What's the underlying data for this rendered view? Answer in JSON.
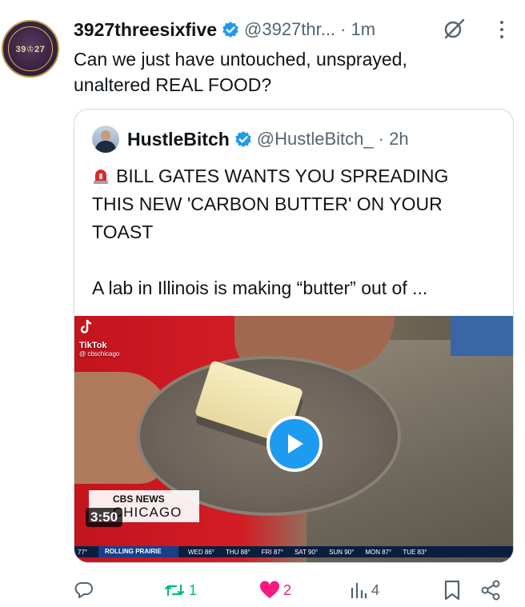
{
  "tweet": {
    "author_name": "3927threesixfive",
    "author_handle": "@3927thr...",
    "time": "· 1m",
    "avatar_text": "39♔27",
    "text_lines": [
      "Can we just have untouched, unsprayed,",
      "unaltered REAL FOOD?"
    ]
  },
  "quote": {
    "author_name": "HustleBitch",
    "author_handle": "@HustleBitch_",
    "time": "· 2h",
    "headline_lines": [
      "BILL GATES WANTS YOU SPREADING",
      "THIS NEW 'CARBON BUTTER' ON YOUR",
      "TOAST"
    ],
    "body_line": "A lab in Illinois is making “butter” out of ...",
    "media": {
      "tiktok_label": "TikTok",
      "tiktok_handle": "@ cbschicago",
      "news_brand": "CBS NEWS",
      "news_city": "CHICAGO",
      "duration": "3:50",
      "ticker_left": "77°",
      "ticker_city": "ROLLING PRAIRIE",
      "ticker_items": [
        "WED 86°",
        "THU 88°",
        "FRI 87°",
        "SAT 90°",
        "SUN 90°",
        "MON 87°",
        "TUE 83°"
      ]
    }
  },
  "actions": {
    "reposts": "1",
    "likes": "2",
    "views": "4"
  },
  "colors": {
    "repost": "#00ba7c",
    "like": "#f91880",
    "verified": "#1d9bf0",
    "muted": "#536471",
    "border": "#cfd9de"
  }
}
